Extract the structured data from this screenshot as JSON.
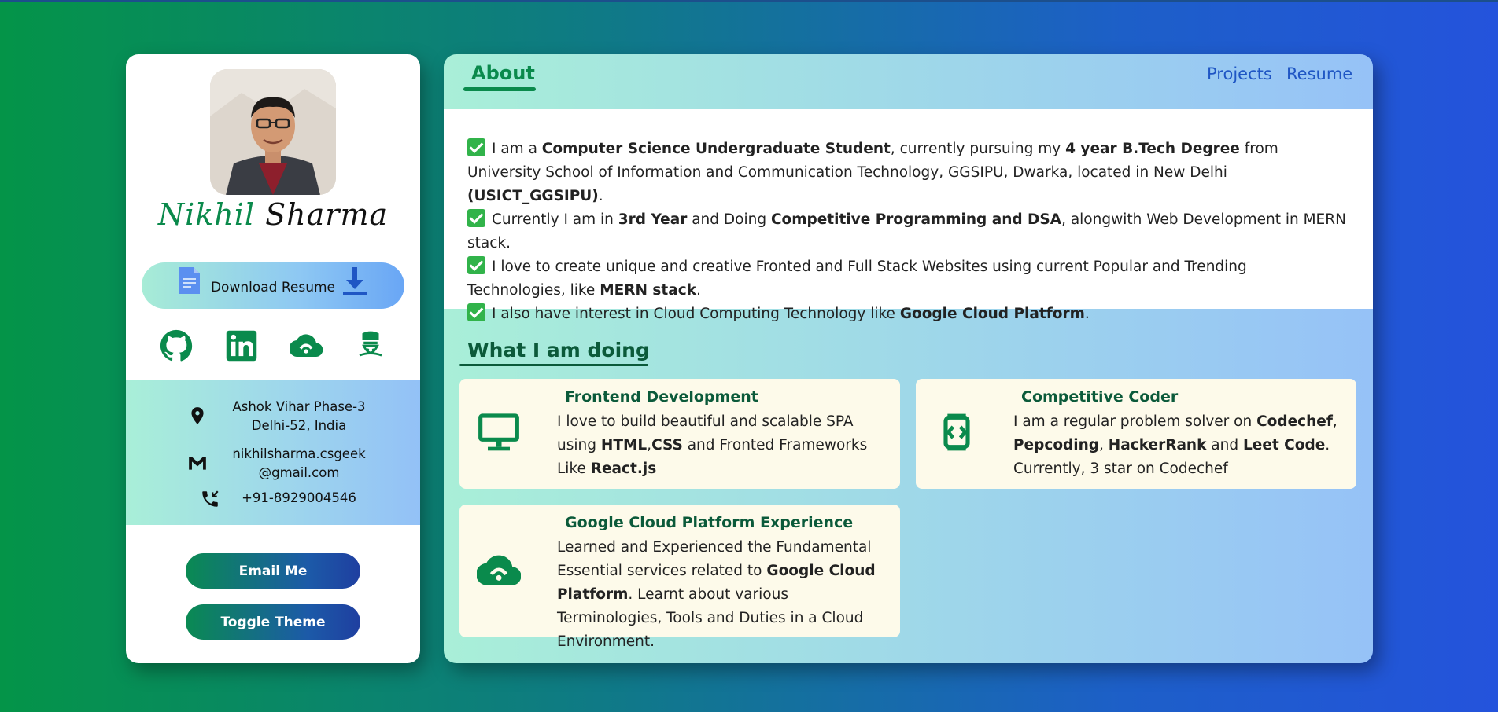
{
  "profile": {
    "first_name": "Nikhil",
    "last_name": "Sharma",
    "download_label": "Download Resume"
  },
  "socials": [
    "github-icon",
    "linkedin-icon",
    "cloud-icon",
    "codechef-icon"
  ],
  "contact": {
    "address_line1": "Ashok Vihar Phase-3",
    "address_line2": "Delhi-52, India",
    "email_line1": "nikhilsharma.csgeek",
    "email_line2": "@gmail.com",
    "phone": "+91-8929004546"
  },
  "buttons": {
    "email": "Email Me",
    "theme": "Toggle Theme"
  },
  "nav": {
    "about": "About",
    "projects": "Projects",
    "resume": "Resume"
  },
  "about": {
    "p1": {
      "t1": "I am a ",
      "b1": "Computer Science Undergraduate Student",
      "t2": ", currently pursuing my ",
      "b2": "4 year B.Tech Degree",
      "t3": " from University School of Information and Communication Technology, GGSIPU, Dwarka, located in New Delhi ",
      "b3": "(USICT_GGSIPU)",
      "t4": "."
    },
    "p2": {
      "t1": "Currently I am in ",
      "b1": "3rd Year",
      "t2": " and Doing ",
      "b2": "Competitive Programming and DSA",
      "t3": ", alongwith Web Development in MERN stack."
    },
    "p3": {
      "t1": "I love to create unique and creative Fronted and Full Stack Websites using current Popular and Trending Technologies, like ",
      "b1": "MERN stack",
      "t2": "."
    },
    "p4": {
      "t1": "I also have interest in Cloud Computing Technology like ",
      "b1": "Google Cloud Platform",
      "t2": "."
    }
  },
  "doing": {
    "title": "What I am doing",
    "frontend": {
      "title": "Frontend Development",
      "t1": "I love to build beautiful and scalable SPA using ",
      "b1": "HTML",
      "t2": ",",
      "b2": "CSS",
      "t3": " and Fronted Frameworks Like ",
      "b3": "React.js"
    },
    "coder": {
      "title": "Competitive Coder",
      "t1": "I am a regular problem solver on ",
      "b1": "Codechef",
      "t2": ", ",
      "b2": "Pepcoding",
      "t3": ", ",
      "b3": "HackerRank",
      "t4": " and ",
      "b4": "Leet Code",
      "t5": ". Currently, 3 star on Codechef"
    },
    "gcp": {
      "title": "Google Cloud Platform Experience",
      "t1": "Learned and Experienced the Fundamental Essential services related to ",
      "b1": "Google Cloud Platform",
      "t2": ". Learnt about various Terminologies, Tools and Duties in a Cloud Environment."
    }
  },
  "colors": {
    "accent_green": "#0a8a4c",
    "link_blue": "#1f56c4",
    "card_bg": "#fdfaea"
  }
}
